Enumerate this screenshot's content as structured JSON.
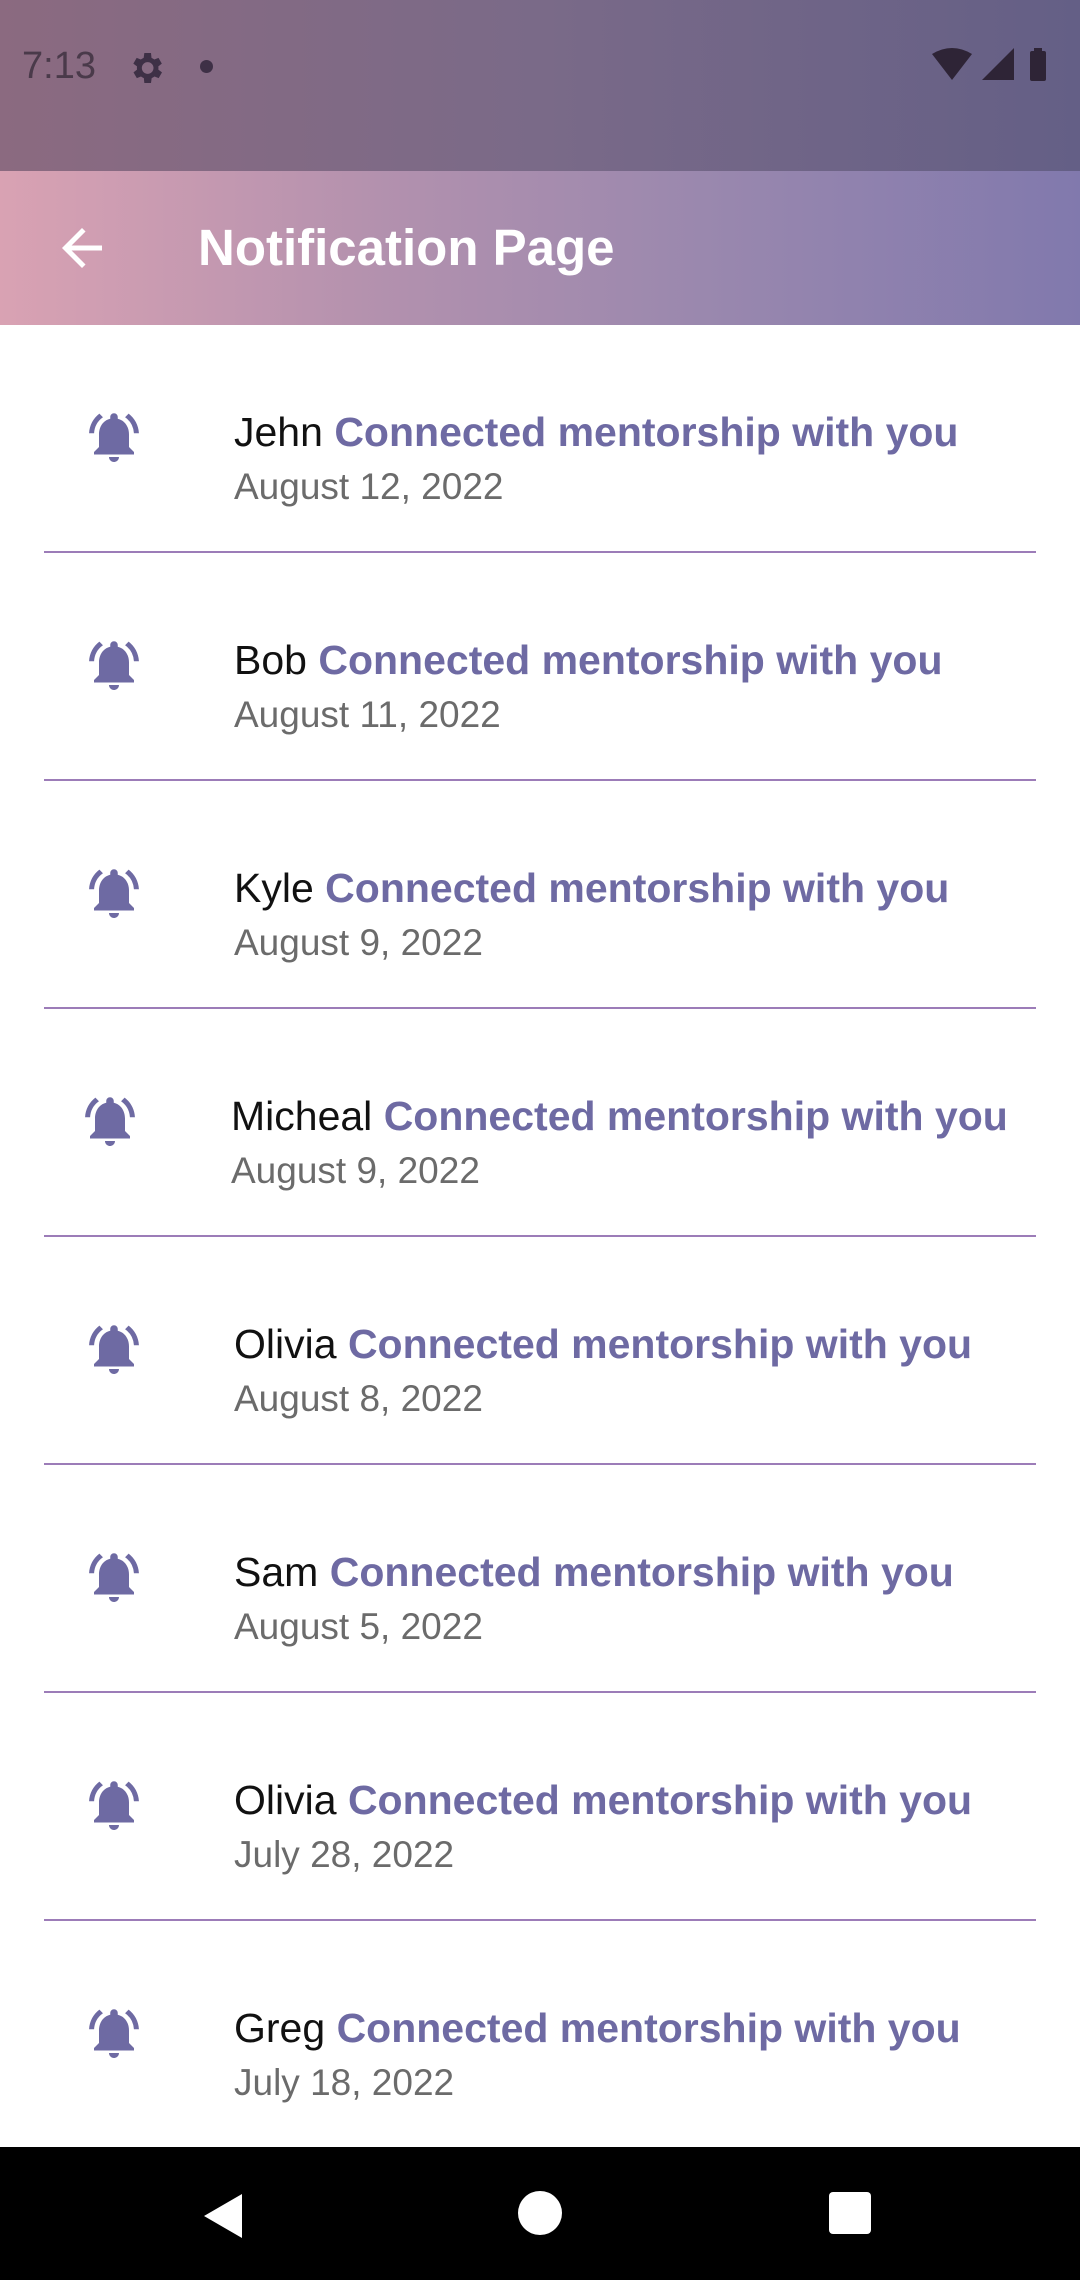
{
  "status_bar": {
    "time": "7:13",
    "icons": [
      "settings-gear-icon",
      "notification-dot-icon",
      "wifi-icon",
      "cellular-signal-icon",
      "battery-icon"
    ]
  },
  "app_bar": {
    "title": "Notification Page",
    "back_icon": "arrow-back-icon"
  },
  "notifications": [
    {
      "name": "Jehn",
      "message": "Connected mentorship with you",
      "date": "August 12, 2022"
    },
    {
      "name": "Bob",
      "message": "Connected mentorship with you",
      "date": "August 11, 2022"
    },
    {
      "name": "Kyle",
      "message": "Connected mentorship with you",
      "date": "August 9, 2022"
    },
    {
      "name": "Micheal",
      "message": "Connected mentorship with you",
      "date": "August 9, 2022"
    },
    {
      "name": "Olivia",
      "message": "Connected mentorship with you",
      "date": "August 8, 2022"
    },
    {
      "name": "Sam",
      "message": "Connected mentorship with you",
      "date": "August 5, 2022"
    },
    {
      "name": "Olivia",
      "message": "Connected mentorship with you",
      "date": "July 28, 2022"
    },
    {
      "name": "Greg",
      "message": "Connected mentorship with you",
      "date": "July 18, 2022"
    }
  ],
  "colors": {
    "accent": "#6e6aa3",
    "divider": "#9c7cb8",
    "bell": "#6e6aa3",
    "app_bar_start": "#d9a2b3",
    "app_bar_end": "#8179ad"
  },
  "nav_bar": {
    "icons": [
      "nav-back-icon",
      "nav-home-icon",
      "nav-recents-icon"
    ]
  }
}
